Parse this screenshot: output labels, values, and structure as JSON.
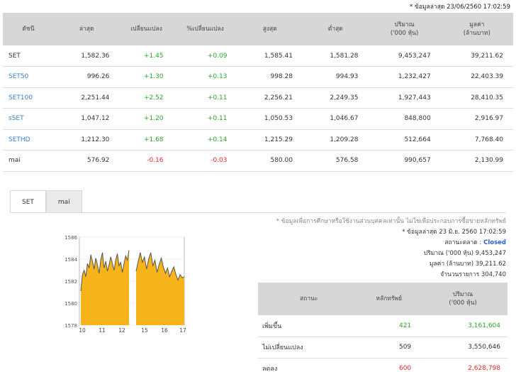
{
  "header_note": "* ข้อมูลล่าสุด 23/06/2560 17:02:59",
  "columns": [
    "ดัชนี",
    "ล่าสุด",
    "เปลี่ยนแปลง",
    "%เปลี่ยนแปลง",
    "สูงสุด",
    "ต่ำสุด",
    "ปริมาณ\n('000 หุ้น)",
    "มูลค่า\n(ล้านบาท)"
  ],
  "indices": [
    {
      "name": "SET",
      "last": "1,582.36",
      "change": "+1.45",
      "pct": "+0.09",
      "high": "1,585.41",
      "low": "1,581.28",
      "volume": "9,453,247",
      "value": "39,211.62",
      "trend": "up",
      "link": false
    },
    {
      "name": "SET50",
      "last": "996.26",
      "change": "+1.30",
      "pct": "+0.13",
      "high": "998.28",
      "low": "994.93",
      "volume": "1,232,427",
      "value": "22,403.39",
      "trend": "up",
      "link": true
    },
    {
      "name": "SET100",
      "last": "2,251.44",
      "change": "+2.52",
      "pct": "+0.11",
      "high": "2,256.21",
      "low": "2,249.35",
      "volume": "1,927,443",
      "value": "28,410.35",
      "trend": "up",
      "link": true
    },
    {
      "name": "sSET",
      "last": "1,047.12",
      "change": "+1.20",
      "pct": "+0.11",
      "high": "1,050.53",
      "low": "1,046.67",
      "volume": "848,800",
      "value": "2,916.97",
      "trend": "up",
      "link": true
    },
    {
      "name": "SETHD",
      "last": "1,212.30",
      "change": "+1.68",
      "pct": "+0.14",
      "high": "1,215.29",
      "low": "1,209.28",
      "volume": "512,664",
      "value": "7,768.40",
      "trend": "up",
      "link": true
    },
    {
      "name": "mai",
      "last": "576.92",
      "change": "-0.16",
      "pct": "-0.03",
      "high": "580.00",
      "low": "576.58",
      "volume": "990,657",
      "value": "2,130.99",
      "trend": "down",
      "link": false
    }
  ],
  "tabs": [
    {
      "label": "SET",
      "active": true
    },
    {
      "label": "mai",
      "active": false
    }
  ],
  "info": {
    "disclaimer": "* ข้อมูลเพื่อการศึกษาหรือใช้งานส่วนบุคคลเท่านั้น ไม่ใช่เพื่อประกอบการซื้อขายหลักทรัพย์",
    "updated": "* ข้อมูลล่าสุด 23 มิ.ย. 2560 17:02:59",
    "market_status_label": "สถานะตลาด :",
    "market_status": "Closed",
    "volume_label": "ปริมาณ ('000 หุ้น)",
    "volume": "9,453,247",
    "value_label": "มูลค่า (ล้านบาท)",
    "value": "39,211.62",
    "trades_label": "จำนวนรายการ",
    "trades": "304,740"
  },
  "stat_columns": [
    "สถานะ",
    "หลักทรัพย์",
    "ปริมาณ\n('000 หุ้น)"
  ],
  "stats": [
    {
      "label": "เพิ่มขึ้น",
      "count": "421",
      "volume": "3,161,604",
      "color": "#2aa52a"
    },
    {
      "label": "ไม่เปลี่ยนแปลง",
      "count": "509",
      "volume": "3,550,646",
      "color": "#333333"
    },
    {
      "label": "ลดลง",
      "count": "600",
      "volume": "2,628,798",
      "color": "#e02a2a"
    }
  ],
  "chart_data": {
    "type": "area",
    "x_ticks": [
      "10",
      "11",
      "12",
      "15",
      "16",
      "17"
    ],
    "y_ticks": [
      "1586",
      "1584",
      "1582",
      "1580",
      "1578"
    ],
    "ylim": [
      1578,
      1586
    ],
    "fill_color": "#f7b41a",
    "line_color": "#555555",
    "session1": [
      1581.1,
      1582.6,
      1583.0,
      1582.4,
      1583.6,
      1583.2,
      1584.4,
      1583.8,
      1583.1,
      1584.1,
      1583.5,
      1582.7,
      1583.9,
      1584.6,
      1583.2,
      1583.8,
      1582.9,
      1583.5,
      1584.2,
      1583.6,
      1583.0,
      1583.9,
      1584.5,
      1583.4,
      1583.7,
      1582.8,
      1583.6,
      1584.3,
      1583.9,
      1584.8
    ],
    "session2": [
      1582.9,
      1583.8,
      1584.6,
      1583.7,
      1584.2,
      1583.1,
      1584.0,
      1584.6,
      1583.4,
      1583.9,
      1582.8,
      1583.5,
      1584.1,
      1583.3,
      1582.7,
      1583.2,
      1582.4,
      1582.9,
      1583.3,
      1582.6,
      1582.1,
      1582.6,
      1582.3,
      1582.4
    ]
  }
}
